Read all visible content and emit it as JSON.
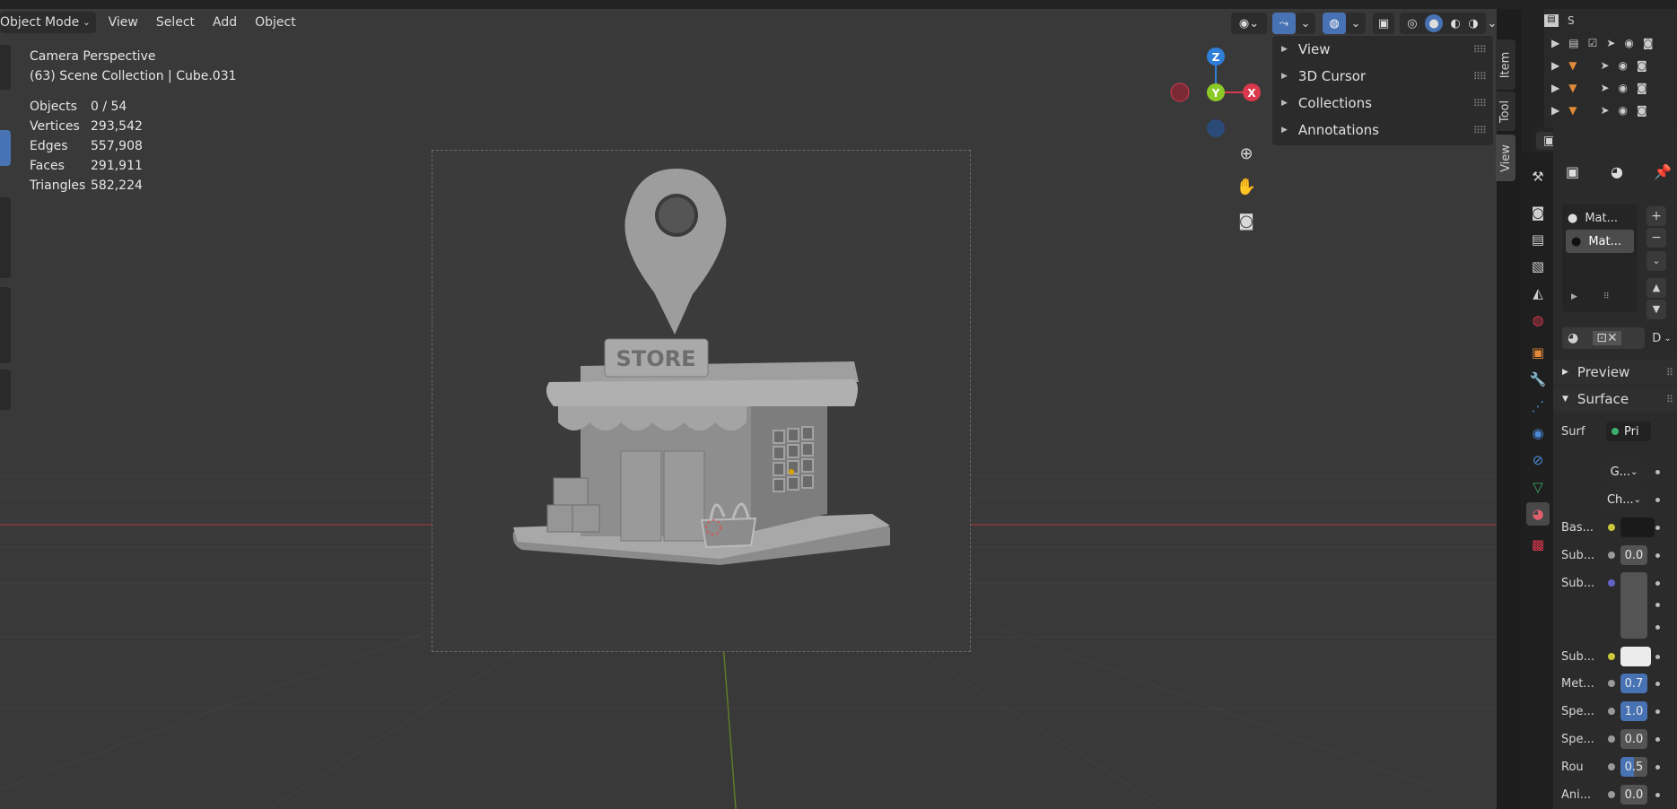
{
  "header": {
    "mode_label": "Object Mode",
    "menus": [
      "View",
      "Select",
      "Add",
      "Object"
    ]
  },
  "overlay": {
    "title": "Camera Perspective",
    "subtitle": "(63) Scene Collection | Cube.031",
    "stats": [
      {
        "label": "Objects",
        "value": "0 / 54"
      },
      {
        "label": "Vertices",
        "value": "293,542"
      },
      {
        "label": "Edges",
        "value": "557,908"
      },
      {
        "label": "Faces",
        "value": "291,911"
      },
      {
        "label": "Triangles",
        "value": "582,224"
      }
    ]
  },
  "scene": {
    "sign_text": "STORE"
  },
  "gizmo": {
    "z": "Z",
    "y": "Y",
    "x": "X"
  },
  "npanel": {
    "items": [
      "View",
      "3D Cursor",
      "Collections",
      "Annotations"
    ],
    "tabs": [
      "Item",
      "Tool",
      "View"
    ]
  },
  "outliner": {
    "scene_label": "S"
  },
  "properties": {
    "materials": [
      "Mat...",
      "Mat..."
    ],
    "material_link": "D",
    "sections": {
      "preview": "Preview",
      "surface": "Surface"
    },
    "surface_label": "Surf",
    "surface_value": "Pri",
    "dropdowns": [
      "G...",
      "Ch..."
    ],
    "fields": [
      {
        "label": "Bas...",
        "value": ""
      },
      {
        "label": "Sub...",
        "value": "0.0"
      },
      {
        "label": "Sub...",
        "value": ""
      },
      {
        "label": "Sub...",
        "value": ""
      },
      {
        "label": "Met...",
        "value": "0.7"
      },
      {
        "label": "Spe...",
        "value": "1.0"
      },
      {
        "label": "Spe...",
        "value": "0.0"
      },
      {
        "label": "Rou",
        "value": "0.5"
      },
      {
        "label": "Ani...",
        "value": "0.0"
      }
    ]
  },
  "colors": {
    "accent": "#4772b3",
    "axis_x": "#d9384d",
    "axis_y": "#8ac926",
    "axis_z": "#2f7ed8"
  }
}
